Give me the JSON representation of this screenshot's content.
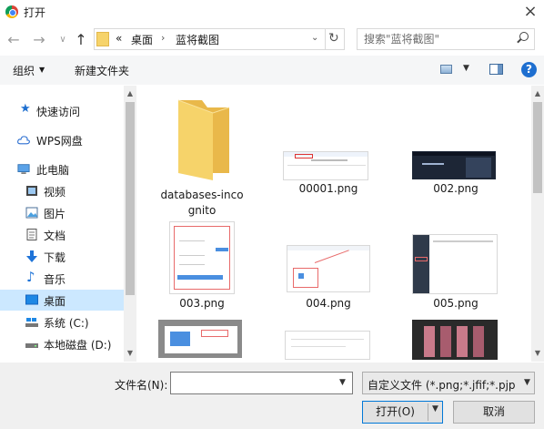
{
  "window": {
    "title": "打开",
    "close_icon": "close-icon"
  },
  "nav": {
    "back_icon": "←",
    "forward_icon": "→",
    "history_icon": "∨",
    "up_icon": "↑",
    "overflow": "«",
    "breadcrumb": [
      "桌面",
      "蓝将截图"
    ],
    "separator": "›",
    "dropdown": "⌄",
    "refresh": "↻"
  },
  "search": {
    "placeholder": "搜索\"蓝将截图\""
  },
  "toolbar": {
    "organize": "组织",
    "organize_arrow": "▼",
    "new_folder": "新建文件夹",
    "view_arrow": "▼",
    "help": "?"
  },
  "sidebar": {
    "items": [
      {
        "label": "快速访问",
        "icon": "star-icon"
      },
      {
        "label": "WPS网盘",
        "icon": "cloud-icon"
      },
      {
        "label": "此电脑",
        "icon": "computer-icon"
      },
      {
        "label": "视频",
        "icon": "video-icon"
      },
      {
        "label": "图片",
        "icon": "picture-icon"
      },
      {
        "label": "文档",
        "icon": "document-icon"
      },
      {
        "label": "下载",
        "icon": "download-icon"
      },
      {
        "label": "音乐",
        "icon": "music-icon"
      },
      {
        "label": "桌面",
        "icon": "desktop-icon",
        "selected": true
      },
      {
        "label": "系统 (C:)",
        "icon": "drive-icon"
      },
      {
        "label": "本地磁盘 (D:)",
        "icon": "drive-icon"
      }
    ]
  },
  "files": [
    {
      "name": "databases-incognito",
      "line1": "databases-inco",
      "line2": "gnito",
      "type": "folder"
    },
    {
      "name": "00001.png",
      "type": "image"
    },
    {
      "name": "002.png",
      "type": "image"
    },
    {
      "name": "003.png",
      "type": "image"
    },
    {
      "name": "004.png",
      "type": "image"
    },
    {
      "name": "005.png",
      "type": "image"
    },
    {
      "name": "",
      "type": "image"
    },
    {
      "name": "",
      "type": "image"
    },
    {
      "name": "",
      "type": "image"
    }
  ],
  "bottom": {
    "filename_label": "文件名(N):",
    "filename_value": "",
    "filetype_value": "自定义文件 (*.png;*.jfif;*.pjpeg",
    "open_button": "打开(O)",
    "cancel_button": "取消"
  },
  "colors": {
    "selection": "#cce8ff",
    "accent": "#0078d7",
    "folder": "#f6d36a"
  }
}
